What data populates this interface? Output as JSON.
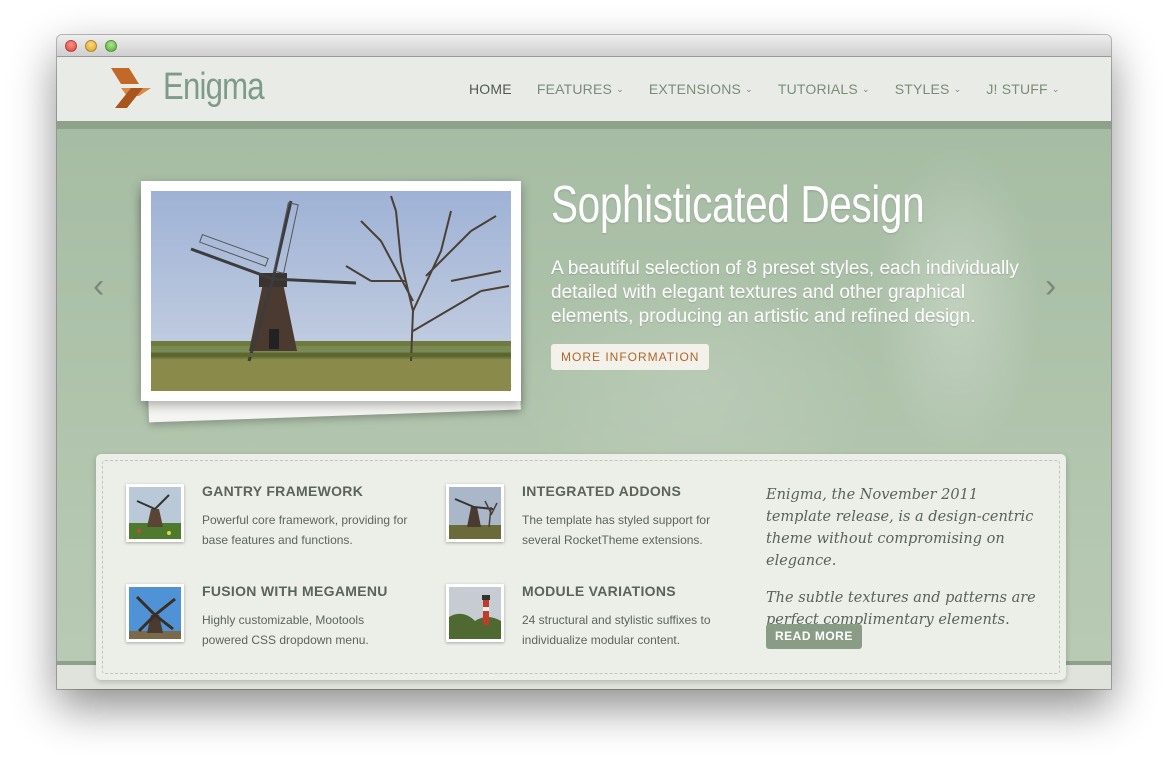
{
  "brand": {
    "name": "Enigma",
    "accent": "#c2692a"
  },
  "nav": {
    "items": [
      {
        "label": "HOME",
        "has_dropdown": false,
        "active": true
      },
      {
        "label": "FEATURES",
        "has_dropdown": true,
        "active": false
      },
      {
        "label": "EXTENSIONS",
        "has_dropdown": true,
        "active": false
      },
      {
        "label": "TUTORIALS",
        "has_dropdown": true,
        "active": false
      },
      {
        "label": "STYLES",
        "has_dropdown": true,
        "active": false
      },
      {
        "label": "J! STUFF",
        "has_dropdown": true,
        "active": false
      }
    ],
    "caret": "⌄"
  },
  "hero": {
    "title": "Sophisticated Design",
    "description": "A beautiful selection of 8 preset styles, each individually detailed with elegant textures and other graphical elements, producing an artistic and refined design.",
    "button_label": "MORE INFORMATION",
    "prev_glyph": "‹",
    "next_glyph": "›",
    "image_icon": "windmill-photo"
  },
  "features": [
    {
      "title": "GANTRY FRAMEWORK",
      "description": "Powerful core framework, providing for base features and functions.",
      "icon": "windmill-thumbnail"
    },
    {
      "title": "INTEGRATED ADDONS",
      "description": "The template has styled support for several RocketTheme extensions.",
      "icon": "windmill-thumbnail"
    },
    {
      "title": "FUSION WITH MEGAMENU",
      "description": "Highly customizable, Mootools powered CSS dropdown menu.",
      "icon": "windmill-sky-thumbnail"
    },
    {
      "title": "MODULE VARIATIONS",
      "description": "24 structural and stylistic suffixes to individualize modular content.",
      "icon": "lighthouse-thumbnail"
    }
  ],
  "aside": {
    "paragraph1": "Enigma, the November 2011 template release, is a design-centric theme without compromising on elegance.",
    "paragraph2": "The subtle textures and patterns are perfect complimentary elements.",
    "button_label": "READ MORE"
  }
}
